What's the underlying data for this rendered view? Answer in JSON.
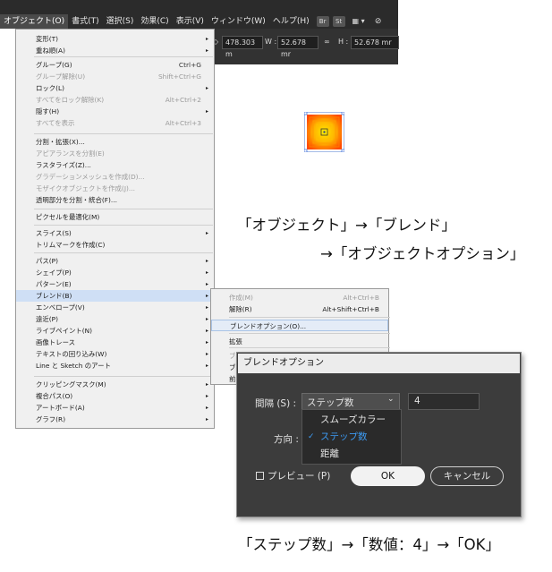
{
  "menubar": {
    "items": [
      "オブジェクト(O)",
      "書式(T)",
      "選択(S)",
      "効果(C)",
      "表示(V)",
      "ウィンドウ(W)",
      "ヘルプ(H)"
    ],
    "tools": [
      "Br",
      "St",
      "▦ ▾",
      "⊘"
    ]
  },
  "controlbar": {
    "x_value": "478.303 m",
    "w_label": "W :",
    "w_value": "52.678 mr",
    "link_icon": "∞",
    "h_label": "H :",
    "h_value": "52.678 mr"
  },
  "menu": {
    "items": [
      {
        "label": "変形(T)",
        "shortcut": "",
        "arrow": "▸",
        "disabled": false
      },
      {
        "label": "重ね順(A)",
        "shortcut": "",
        "arrow": "▸",
        "disabled": false
      },
      {
        "label": "グループ(G)",
        "shortcut": "Ctrl+G",
        "arrow": "",
        "disabled": false
      },
      {
        "label": "グループ解除(U)",
        "shortcut": "Shift+Ctrl+G",
        "arrow": "",
        "disabled": true
      },
      {
        "label": "ロック(L)",
        "shortcut": "",
        "arrow": "▸",
        "disabled": false
      },
      {
        "label": "すべてをロック解除(K)",
        "shortcut": "Alt+Ctrl+2",
        "arrow": "",
        "disabled": true
      },
      {
        "label": "隠す(H)",
        "shortcut": "",
        "arrow": "▸",
        "disabled": false
      },
      {
        "label": "すべてを表示",
        "shortcut": "Alt+Ctrl+3",
        "arrow": "",
        "disabled": true
      },
      {
        "label": "分割・拡張(X)...",
        "shortcut": "",
        "arrow": "",
        "disabled": false
      },
      {
        "label": "アピアランスを分割(E)",
        "shortcut": "",
        "arrow": "",
        "disabled": true
      },
      {
        "label": "ラスタライズ(Z)...",
        "shortcut": "",
        "arrow": "",
        "disabled": false
      },
      {
        "label": "グラデーションメッシュを作成(D)...",
        "shortcut": "",
        "arrow": "",
        "disabled": true
      },
      {
        "label": "モザイクオブジェクトを作成(J)...",
        "shortcut": "",
        "arrow": "",
        "disabled": true
      },
      {
        "label": "透明部分を分割・統合(F)...",
        "shortcut": "",
        "arrow": "",
        "disabled": false
      },
      {
        "label": "ピクセルを最適化(M)",
        "shortcut": "",
        "arrow": "",
        "disabled": false
      },
      {
        "label": "スライス(S)",
        "shortcut": "",
        "arrow": "▸",
        "disabled": false
      },
      {
        "label": "トリムマークを作成(C)",
        "shortcut": "",
        "arrow": "",
        "disabled": false
      },
      {
        "label": "パス(P)",
        "shortcut": "",
        "arrow": "▸",
        "disabled": false
      },
      {
        "label": "シェイプ(P)",
        "shortcut": "",
        "arrow": "▸",
        "disabled": false
      },
      {
        "label": "パターン(E)",
        "shortcut": "",
        "arrow": "▸",
        "disabled": false
      },
      {
        "label": "ブレンド(B)",
        "shortcut": "",
        "arrow": "▸",
        "disabled": false,
        "highlighted": true
      },
      {
        "label": "エンベロープ(V)",
        "shortcut": "",
        "arrow": "▸",
        "disabled": false
      },
      {
        "label": "遠近(P)",
        "shortcut": "",
        "arrow": "▸",
        "disabled": false
      },
      {
        "label": "ライブペイント(N)",
        "shortcut": "",
        "arrow": "▸",
        "disabled": false
      },
      {
        "label": "画像トレース",
        "shortcut": "",
        "arrow": "▸",
        "disabled": false
      },
      {
        "label": "テキストの回り込み(W)",
        "shortcut": "",
        "arrow": "▸",
        "disabled": false
      },
      {
        "label": "Line と Sketch のアート",
        "shortcut": "",
        "arrow": "▸",
        "disabled": false
      },
      {
        "label": "クリッピングマスク(M)",
        "shortcut": "",
        "arrow": "▸",
        "disabled": false
      },
      {
        "label": "複合パス(O)",
        "shortcut": "",
        "arrow": "▸",
        "disabled": false
      },
      {
        "label": "アートボード(A)",
        "shortcut": "",
        "arrow": "▸",
        "disabled": false
      },
      {
        "label": "グラフ(R)",
        "shortcut": "",
        "arrow": "▸",
        "disabled": false
      }
    ]
  },
  "submenu": {
    "items": [
      {
        "label": "作成(M)",
        "shortcut": "Alt+Ctrl+B",
        "disabled": true
      },
      {
        "label": "解除(R)",
        "shortcut": "Alt+Shift+Ctrl+B",
        "disabled": false
      },
      {
        "label": "ブレンドオプション(O)...",
        "shortcut": "",
        "disabled": false,
        "highlighted": true
      },
      {
        "label": "拡張",
        "shortcut": "",
        "disabled": false
      },
      {
        "label": "ブ",
        "shortcut": "",
        "disabled": true
      },
      {
        "label": "ブ",
        "shortcut": "",
        "disabled": false
      },
      {
        "label": "前",
        "shortcut": "",
        "disabled": false
      }
    ]
  },
  "captions": {
    "line1": "「オブジェクト」→「ブレンド」",
    "line2": "→「オブジェクトオプション」",
    "line3": "「ステップ数」→「数値：4」→「OK」"
  },
  "dialog": {
    "title": "ブレンドオプション",
    "spacing_label": "間隔 (S) :",
    "spacing_selected": "ステップ数",
    "spacing_value": "4",
    "orientation_label": "方向 :",
    "options": [
      "スムーズカラー",
      "ステップ数",
      "距離"
    ],
    "selected_option": "ステップ数",
    "preview_label": "プレビュー (P)",
    "ok_label": "OK",
    "cancel_label": "キャンセル"
  },
  "colors": {
    "menubar_bg": "#2b2b2b",
    "menu_bg": "#f0f0f0",
    "highlight": "#cfdff5",
    "dialog_bg": "#3c3c3c",
    "selected_option": "#3d9cf5",
    "art_outer": "#ff5a00",
    "art_inner": "#ffe600"
  }
}
